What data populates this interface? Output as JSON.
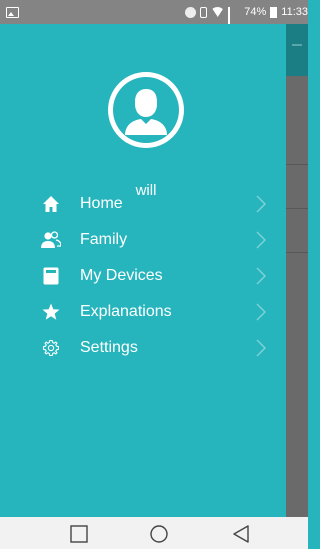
{
  "status_bar": {
    "battery_text": "74%",
    "time": "11:33",
    "icons": [
      "gallery-icon",
      "sync-icon",
      "vibrate-icon",
      "wifi-icon",
      "signal-icon",
      "battery-icon"
    ]
  },
  "drawer": {
    "avatar_icon": "user-avatar-icon",
    "username": "will",
    "items": [
      {
        "label": "Home",
        "icon": "home-icon"
      },
      {
        "label": "Family",
        "icon": "family-icon"
      },
      {
        "label": "My Devices",
        "icon": "devices-icon"
      },
      {
        "label": "Explanations",
        "icon": "star-icon"
      },
      {
        "label": "Settings",
        "icon": "gear-icon"
      }
    ]
  },
  "nav_bar": {
    "buttons": [
      "recent-apps-button",
      "home-button",
      "back-button"
    ]
  },
  "colors": {
    "drawer_bg": "#26b5bd",
    "status_bar_bg": "#848484",
    "nav_bar_bg": "#f2f2f2",
    "text": "#ffffff"
  }
}
